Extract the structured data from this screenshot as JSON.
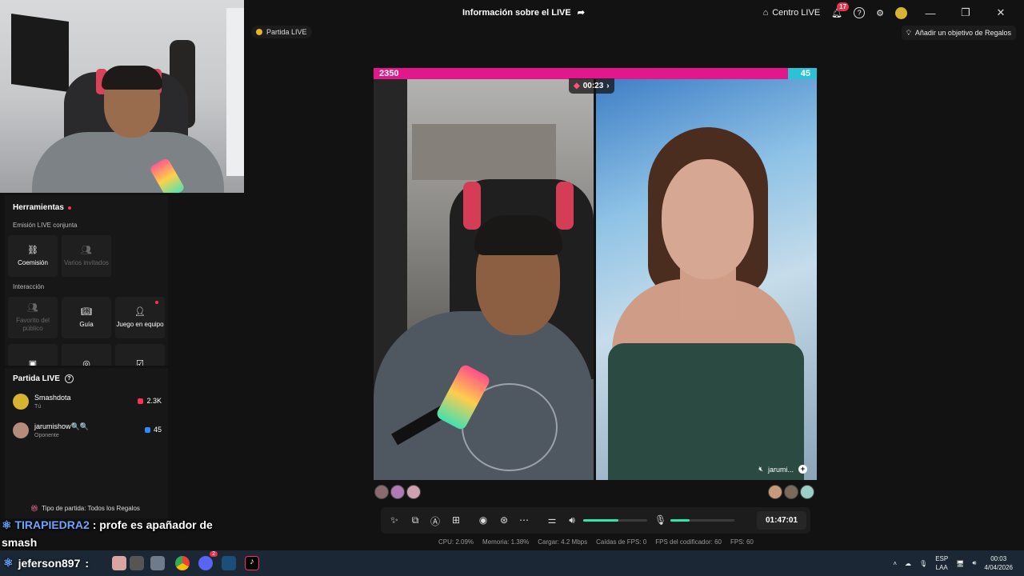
{
  "titlebar": {
    "title": "Información sobre el LIVE",
    "centro_live": "Centro LIVE",
    "notif_count": "17",
    "help_glyph": "?",
    "window_controls": [
      "—",
      "❐",
      "✕"
    ]
  },
  "partida_tag": "Partida LIVE",
  "gift_goal": "Añadir un objetivo de Regalos",
  "tools": {
    "title": "Herramientas",
    "section1": "Emisión LIVE conjunta",
    "tiles1": [
      {
        "label": "Coemisión",
        "icon": "link-icon"
      },
      {
        "label": "Varios invitados",
        "icon": "users-icon"
      }
    ],
    "section2": "Interacción",
    "tiles2": [
      {
        "label": "Favorito del público",
        "icon": "users-icon"
      },
      {
        "label": "Guía",
        "icon": "book-icon"
      },
      {
        "label": "Juego en equipo",
        "icon": "team-icon"
      }
    ]
  },
  "partida": {
    "title": "Partida LIVE",
    "players": [
      {
        "name": "Smashdota",
        "sub": "Tú",
        "score": "2.3K",
        "color": "#ff2f55"
      },
      {
        "name": "jarumishow🔍🔍",
        "sub": "Oponente",
        "score": "45",
        "color": "#2a8cff"
      }
    ],
    "tipo": "Tipo de partida: Todos los Regalos"
  },
  "chat": [
    {
      "user": "TIRAPIEDRA2",
      "message": " : profe es apañador de smash"
    },
    {
      "user": "jeferson897",
      "message": " :"
    }
  ],
  "battle": {
    "score_left": "2350",
    "score_right": "45",
    "timer": "00:23",
    "opponent_label": "jarumi..."
  },
  "controls": {
    "volume": 0.55,
    "mic": 0.3,
    "elapsed": "01:47:01"
  },
  "stats": [
    "CPU: 2.09%",
    "Memoria: 1.38%",
    "Cargar: 4.2 Mbps",
    "Caídas de FPS: 0",
    "FPS del codificador: 60",
    "FPS: 60"
  ],
  "taskbar": {
    "lang1": "ESP",
    "lang2": "LAA",
    "time": "00:03",
    "date": "4/04/2026",
    "discord_badge": "2"
  },
  "colors": {
    "accent_pink": "#e2178c",
    "accent_teal": "#2ac2d4",
    "slider_green": "#2ee6a8"
  }
}
